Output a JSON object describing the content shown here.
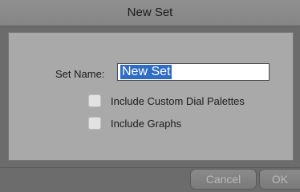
{
  "dialog": {
    "title": "New Set",
    "set_name_label": "Set Name:",
    "set_name_value": "New Set",
    "options": [
      {
        "label": "Include Custom Dial Palettes",
        "checked": false
      },
      {
        "label": "Include Graphs",
        "checked": false
      }
    ],
    "buttons": {
      "cancel_label": "Cancel",
      "ok_label": "OK"
    }
  }
}
